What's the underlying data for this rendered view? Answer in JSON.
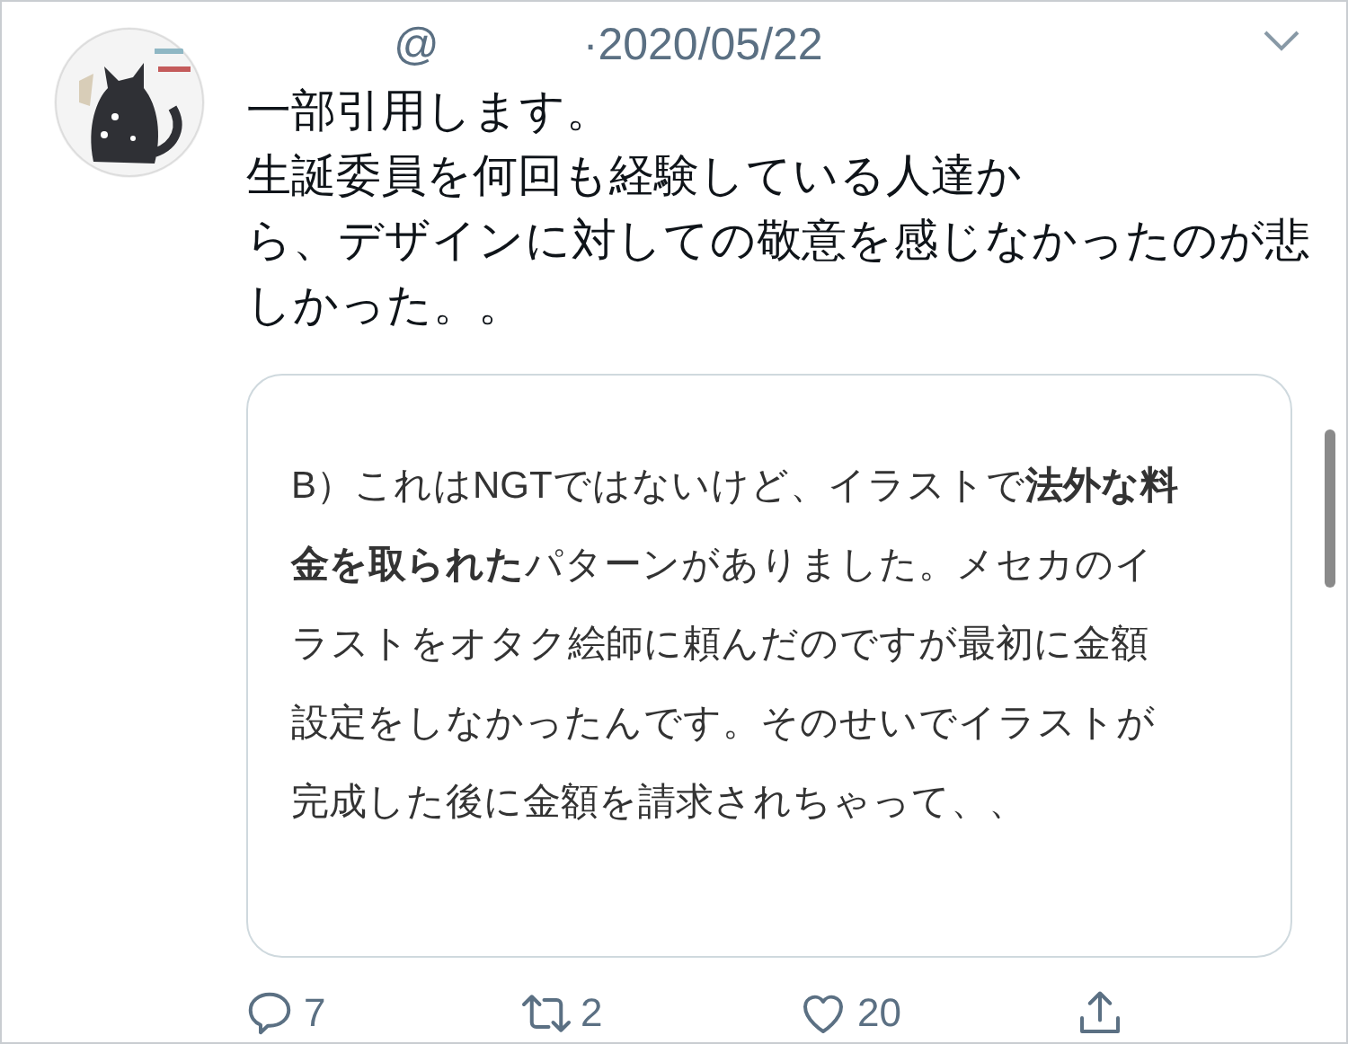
{
  "tweet": {
    "handle_at": "@",
    "date": "·2020/05/22",
    "body_lines": [
      "一部引用します。",
      "生誕委員を何回も経験している人達か",
      "ら、デザインに対しての敬意を感じなかったのが悲",
      "しかった。。"
    ],
    "quoted_image": {
      "lines": [
        "B）これはNGTではないけど、イラストで**法外な料**",
        "**金を取られた**パターンがありました。メセカのイ",
        "ラストをオタク絵師に頼んだのですが最初に金額",
        "設定をしなかったんです。そのせいでイラストが",
        "完成した後に金額を請求されちゃって、、"
      ]
    },
    "actions": [
      {
        "kind": "reply",
        "count": "7"
      },
      {
        "kind": "retweet",
        "count": "2"
      },
      {
        "kind": "like",
        "count": "20"
      },
      {
        "kind": "share"
      }
    ]
  }
}
